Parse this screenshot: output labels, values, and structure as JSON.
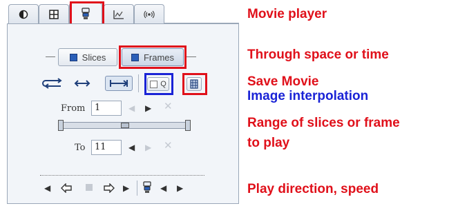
{
  "tabs": [
    {
      "icon": "contrast-icon",
      "active": false
    },
    {
      "icon": "grid-icon",
      "active": false
    },
    {
      "icon": "movie-player-icon",
      "active": true
    },
    {
      "icon": "curve-icon",
      "active": false
    },
    {
      "icon": "broadcast-icon",
      "active": false
    }
  ],
  "mode_toggle": {
    "slices_label": "Slices",
    "frames_label": "Frames",
    "selected": "Frames"
  },
  "interpolation_label": "Q",
  "range": {
    "from_label": "From",
    "from_value": "1",
    "to_label": "To",
    "to_value": "11"
  },
  "annotations": {
    "movie_player": "Movie player",
    "through_space": "Through space or time",
    "save_movie": "Save Movie",
    "image_interpolation": "Image interpolation",
    "range_line1": "Range of slices or frame",
    "range_line2": "to play",
    "play_direction": "Play direction, speed"
  },
  "colors": {
    "highlight_red": "#e0101a",
    "highlight_blue": "#1a23d6",
    "panel_bg": "#f2f5f9",
    "accent": "#2b5fb8"
  }
}
